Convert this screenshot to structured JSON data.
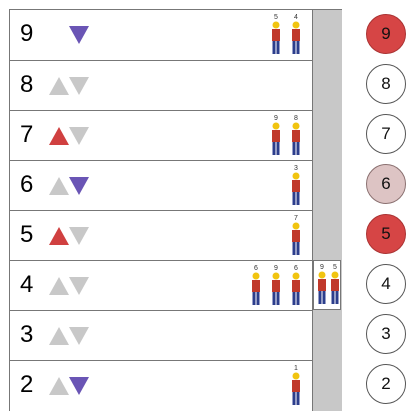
{
  "floors": [
    {
      "number": "9",
      "up": null,
      "down": "active",
      "people": [
        "5",
        "4"
      ]
    },
    {
      "number": "8",
      "up": "inactive",
      "down": "inactive",
      "people": []
    },
    {
      "number": "7",
      "up": "active",
      "down": "inactive",
      "people": [
        "9",
        "8"
      ]
    },
    {
      "number": "6",
      "up": "inactive",
      "down": "active",
      "people": [
        "3"
      ]
    },
    {
      "number": "5",
      "up": "active",
      "down": "inactive",
      "people": [
        "7"
      ]
    },
    {
      "number": "4",
      "up": "inactive",
      "down": "inactive",
      "people": [
        "6",
        "9",
        "6"
      ]
    },
    {
      "number": "3",
      "up": "inactive",
      "down": "inactive",
      "people": []
    },
    {
      "number": "2",
      "up": "inactive",
      "down": "active",
      "people": [
        "1"
      ]
    }
  ],
  "elevator": {
    "current_floor": "4",
    "riders": [
      "9",
      "5"
    ]
  },
  "call_buttons": [
    {
      "label": "9",
      "state": "active"
    },
    {
      "label": "8",
      "state": "idle"
    },
    {
      "label": "7",
      "state": "idle"
    },
    {
      "label": "6",
      "state": "pending"
    },
    {
      "label": "5",
      "state": "active"
    },
    {
      "label": "4",
      "state": "idle"
    },
    {
      "label": "3",
      "state": "idle"
    },
    {
      "label": "2",
      "state": "idle"
    }
  ],
  "colors": {
    "up_active": "#d04040",
    "down_active": "#6a55b5",
    "arrow_inactive": "#c8c8c8",
    "call_active": "#d64545",
    "call_pending": "#ddc4c4",
    "shaft": "#c8c8c8",
    "person_shirt": "#c0392b",
    "person_pants": "#2c3e8c",
    "person_hair": "#f1c40f"
  }
}
